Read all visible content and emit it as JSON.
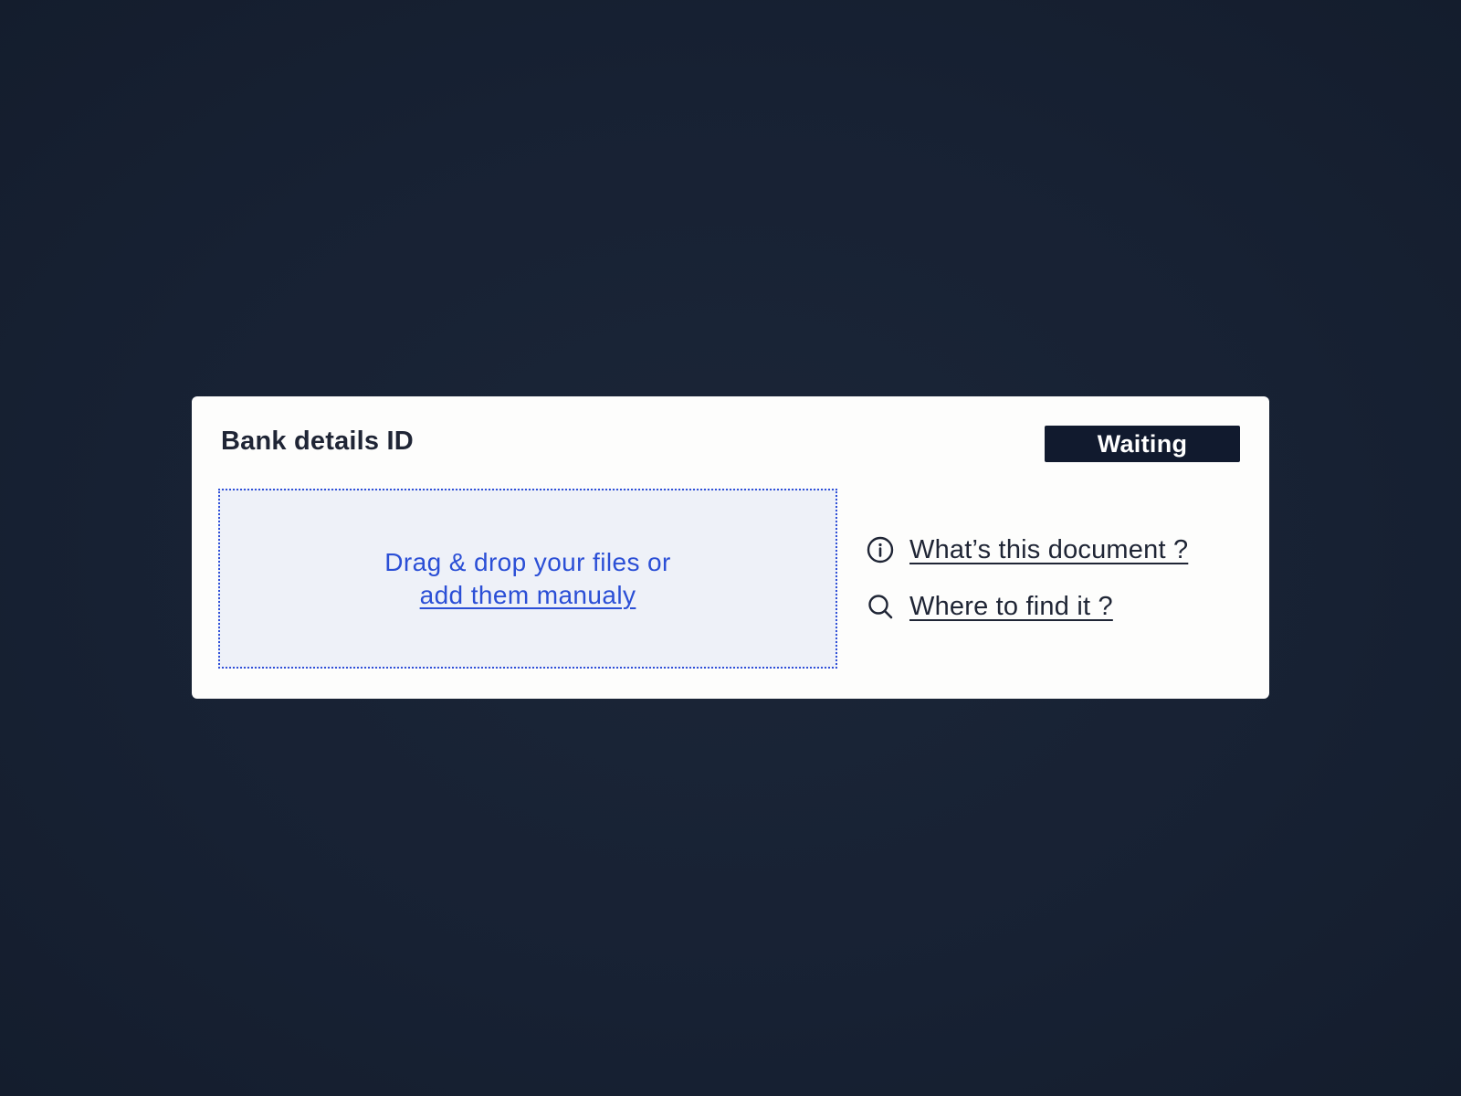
{
  "card": {
    "title": "Bank details ID",
    "status": "Waiting"
  },
  "dropzone": {
    "prompt": "Drag & drop your files or",
    "link_label": "add them manualy"
  },
  "help": {
    "items": [
      {
        "label": "What’s this document ?",
        "icon": "info-icon"
      },
      {
        "label": "Where to find it ?",
        "icon": "search-icon"
      }
    ]
  },
  "colors": {
    "background": "#182233",
    "card": "#fdfdfc",
    "badge": "#111a2e",
    "accent": "#2b4fd6",
    "text": "#1f2535"
  }
}
